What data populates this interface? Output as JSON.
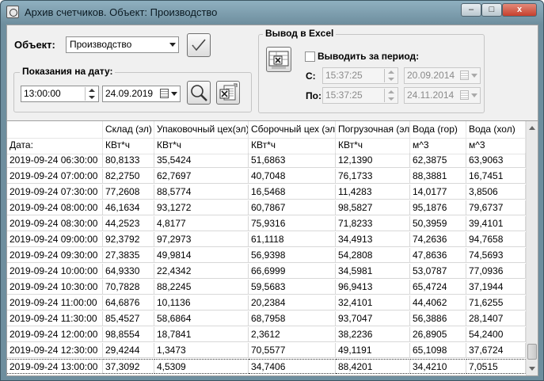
{
  "window": {
    "title": "Архив счетчиков. Объект: Производство",
    "min_label": "–",
    "max_label": "□",
    "close_label": "x"
  },
  "object_section": {
    "label": "Объект:",
    "selected": "Производство"
  },
  "date_group": {
    "title": "Показания на дату:",
    "time_value": "13:00:00",
    "date_value": "24.09.2019"
  },
  "excel_group": {
    "title": "Вывод в Excel",
    "period_checkbox_label": "Выводить за период:",
    "period_checked": false,
    "from_label": "С:",
    "to_label": "По:",
    "from_time": "15:37:25",
    "from_date": "20.09.2014",
    "to_time": "15:37:25",
    "to_date": "24.11.2014"
  },
  "table": {
    "headers": [
      "",
      "Склад (эл)",
      "Упаковочный цех(эл)",
      "Сборочный цех (эл)",
      "Погрузочная (эл)",
      "Вода (гор)",
      "Вода (хол)"
    ],
    "units": [
      "Дата:",
      "КВт*ч",
      "КВт*ч",
      "КВт*ч",
      "КВт*ч",
      "м^3",
      "м^3"
    ],
    "rows": [
      [
        "2019-09-24 06:30:00",
        "80,8133",
        "35,5424",
        "51,6863",
        "12,1390",
        "62,3875",
        "63,9063"
      ],
      [
        "2019-09-24 07:00:00",
        "82,2750",
        "62,7697",
        "40,7048",
        "76,1733",
        "88,3881",
        "16,7451"
      ],
      [
        "2019-09-24 07:30:00",
        "77,2608",
        "88,5774",
        "16,5468",
        "11,4283",
        "14,0177",
        "3,8506"
      ],
      [
        "2019-09-24 08:00:00",
        "46,1634",
        "93,1272",
        "60,7867",
        "98,5827",
        "95,1876",
        "79,6737"
      ],
      [
        "2019-09-24 08:30:00",
        "44,2523",
        "4,8177",
        "75,9316",
        "71,8233",
        "50,3959",
        "39,4101"
      ],
      [
        "2019-09-24 09:00:00",
        "92,3792",
        "97,2973",
        "61,1118",
        "34,4913",
        "74,2636",
        "94,7658"
      ],
      [
        "2019-09-24 09:30:00",
        "27,3835",
        "49,9814",
        "56,9398",
        "54,2808",
        "47,8636",
        "74,5693"
      ],
      [
        "2019-09-24 10:00:00",
        "64,9330",
        "22,4342",
        "66,6999",
        "34,5981",
        "53,0787",
        "77,0936"
      ],
      [
        "2019-09-24 10:30:00",
        "70,7828",
        "88,2245",
        "59,5683",
        "96,9413",
        "65,4724",
        "37,1944"
      ],
      [
        "2019-09-24 11:00:00",
        "64,6876",
        "10,1136",
        "20,2384",
        "32,4101",
        "44,4062",
        "71,6255"
      ],
      [
        "2019-09-24 11:30:00",
        "85,4527",
        "58,6864",
        "68,7958",
        "93,7047",
        "56,3886",
        "28,1407"
      ],
      [
        "2019-09-24 12:00:00",
        "98,8554",
        "18,7841",
        "2,3612",
        "38,2236",
        "26,8905",
        "54,2400"
      ],
      [
        "2019-09-24 12:30:00",
        "29,4244",
        "1,3473",
        "70,5577",
        "49,1191",
        "65,1098",
        "37,6724"
      ],
      [
        "2019-09-24 13:00:00",
        "37,3092",
        "4,5309",
        "34,7406",
        "88,4201",
        "34,4210",
        "7,0515"
      ]
    ]
  }
}
